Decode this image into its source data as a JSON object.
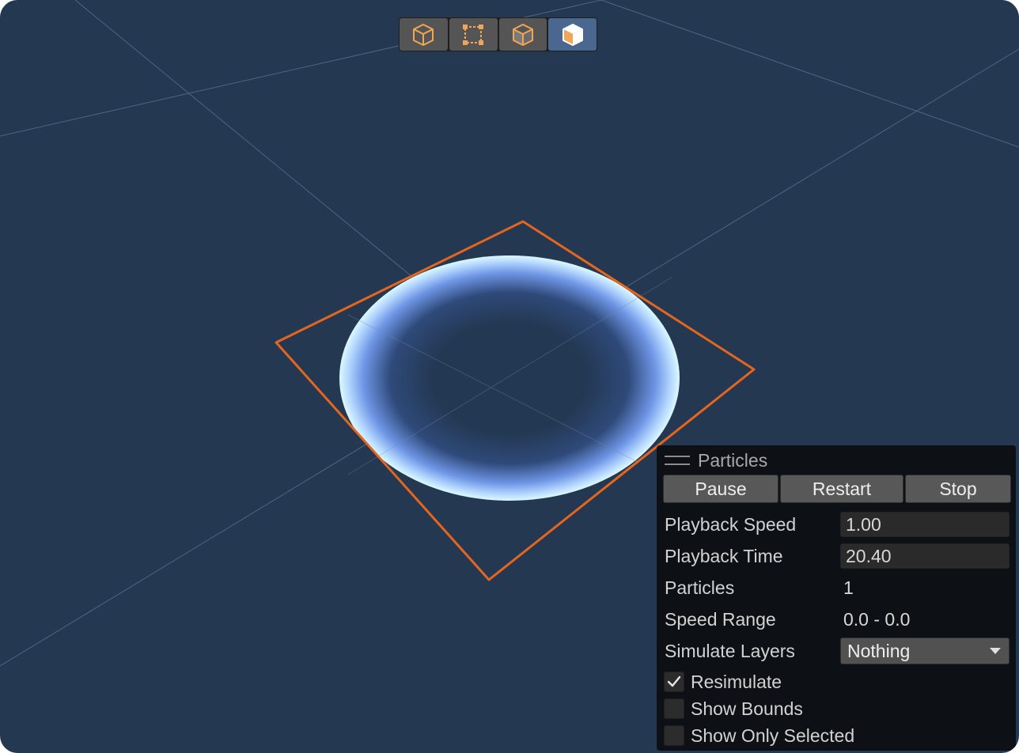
{
  "toolbar": {
    "buttons": [
      {
        "icon": "wireframe-cube-icon",
        "active": false
      },
      {
        "icon": "rect-transform-icon",
        "active": false
      },
      {
        "icon": "shaded-cube-icon",
        "active": false
      },
      {
        "icon": "solid-cube-icon",
        "active": true
      }
    ]
  },
  "colors": {
    "background": "#243852",
    "bounds": "#e4661e",
    "icon_orange": "#f0a656",
    "particle_edge": "#c8f4ff"
  },
  "panel": {
    "title": "Particles",
    "buttons": {
      "pause": "Pause",
      "restart": "Restart",
      "stop": "Stop"
    },
    "playback_speed": {
      "label": "Playback Speed",
      "value": "1.00"
    },
    "playback_time": {
      "label": "Playback Time",
      "value": "20.40"
    },
    "particles": {
      "label": "Particles",
      "value": "1"
    },
    "speed_range": {
      "label": "Speed Range",
      "value": "0.0 - 0.0"
    },
    "simulate_layers": {
      "label": "Simulate Layers",
      "value": "Nothing"
    },
    "resimulate": {
      "label": "Resimulate",
      "checked": true
    },
    "show_bounds": {
      "label": "Show Bounds",
      "checked": false
    },
    "show_only_selected": {
      "label": "Show Only Selected",
      "checked": false
    }
  }
}
